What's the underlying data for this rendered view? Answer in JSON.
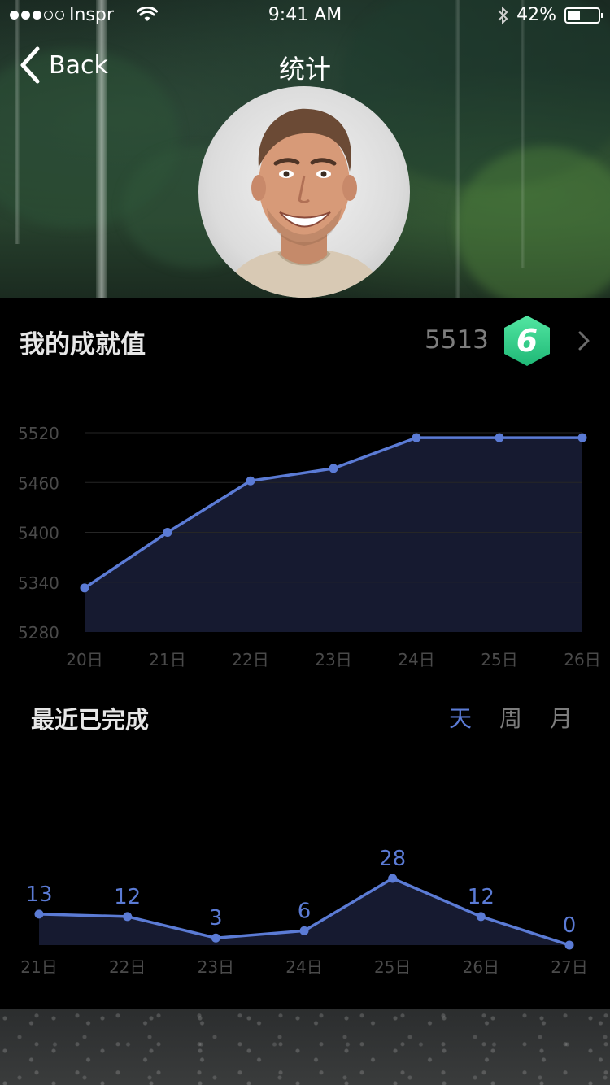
{
  "status_bar": {
    "carrier": "Inspr",
    "time": "9:41 AM",
    "battery": "42%",
    "battery_level": 0.42,
    "icons": [
      "signal-dots-icon",
      "wifi-icon",
      "bluetooth-icon",
      "battery-icon"
    ]
  },
  "nav": {
    "back_label": "Back",
    "title": "统计"
  },
  "achievement": {
    "label": "我的成就值",
    "value": "5513",
    "badge": "6",
    "badge_color": "#2fd38a"
  },
  "recent": {
    "title": "最近已完成",
    "tabs": [
      "天",
      "周",
      "月"
    ],
    "active_tab": "天"
  },
  "colors": {
    "accent": "#5b7bd5",
    "area_fill": "#161a30",
    "muted_text": "#4a4a4a",
    "background": "#000000"
  },
  "chart_data": [
    {
      "type": "area",
      "categories": [
        "20日",
        "21日",
        "22日",
        "23日",
        "24日",
        "25日",
        "26日"
      ],
      "values": [
        5333,
        5400,
        5462,
        5477,
        5514,
        5514,
        5514
      ],
      "yticks": [
        "5520",
        "5460",
        "5400",
        "5340",
        "5280"
      ],
      "ylim": [
        5280,
        5520
      ],
      "grid": true
    },
    {
      "type": "area",
      "categories": [
        "21日",
        "22日",
        "23日",
        "24日",
        "25日",
        "26日",
        "27日"
      ],
      "values": [
        13,
        12,
        3,
        6,
        28,
        12,
        0
      ],
      "data_labels": [
        "13",
        "12",
        "3",
        "6",
        "28",
        "12",
        "0"
      ],
      "grid": false
    }
  ]
}
